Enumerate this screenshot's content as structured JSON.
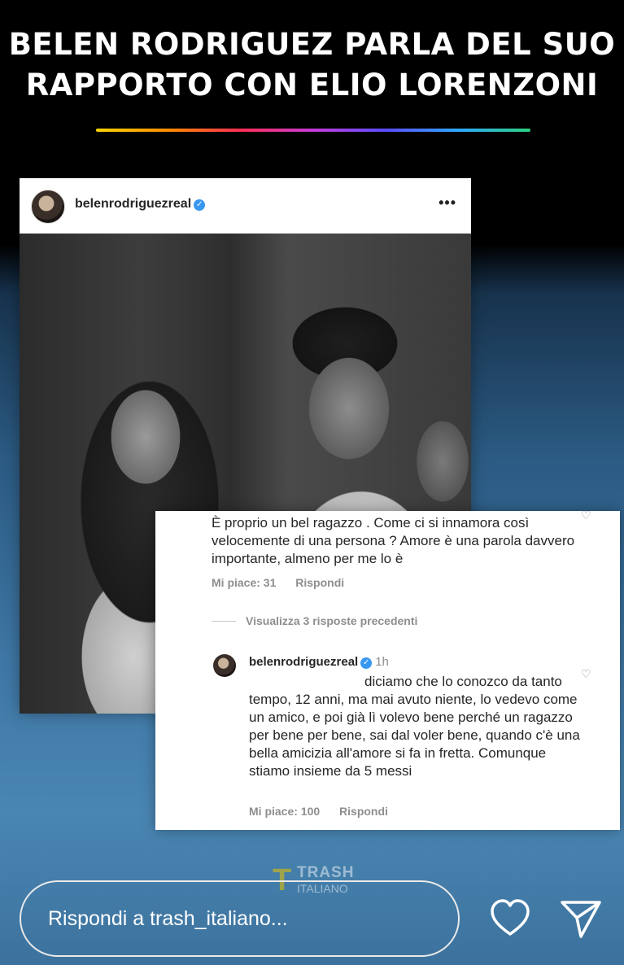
{
  "headline": {
    "line1": "BELEN RODRIGUEZ PARLA DEL SUO",
    "line2": "RAPPORTO CON ELIO LORENZONI"
  },
  "post": {
    "username": "belenrodriguezreal",
    "verified_icon": "verified-badge",
    "more_icon": "•••"
  },
  "comment1": {
    "text": "È proprio un bel ragazzo . Come ci si innamora così velocemente di una persona ? Amore è una parola davvero importante, almeno per me lo è",
    "likes": "Mi piace: 31",
    "reply_label": "Rispondi"
  },
  "view_replies": "Visualizza 3 risposte precedenti",
  "reply": {
    "username": "belenrodriguezreal",
    "time": "1h",
    "text": "diciamo che lo conozco da tanto tempo, 12 anni, ma mai avuto niente, lo vedevo come un amico, e poi già lì volevo bene perché un ragazzo per bene per bene, sai dal voler bene, quando c'è una bella amicizia all'amore si fa in fretta. Comunque stiamo insieme da 5 messi",
    "likes": "Mi piace: 100",
    "reply_label": "Rispondi"
  },
  "watermark": {
    "title": "TRASH",
    "subtitle": "ITALIANO"
  },
  "reply_bar": {
    "placeholder": "Rispondi a trash_italiano..."
  },
  "colors": {
    "verified": "#3897f0",
    "meta_gray": "#8e8e8e",
    "background_top": "#000000",
    "background_bottom": "#4a86b3"
  }
}
